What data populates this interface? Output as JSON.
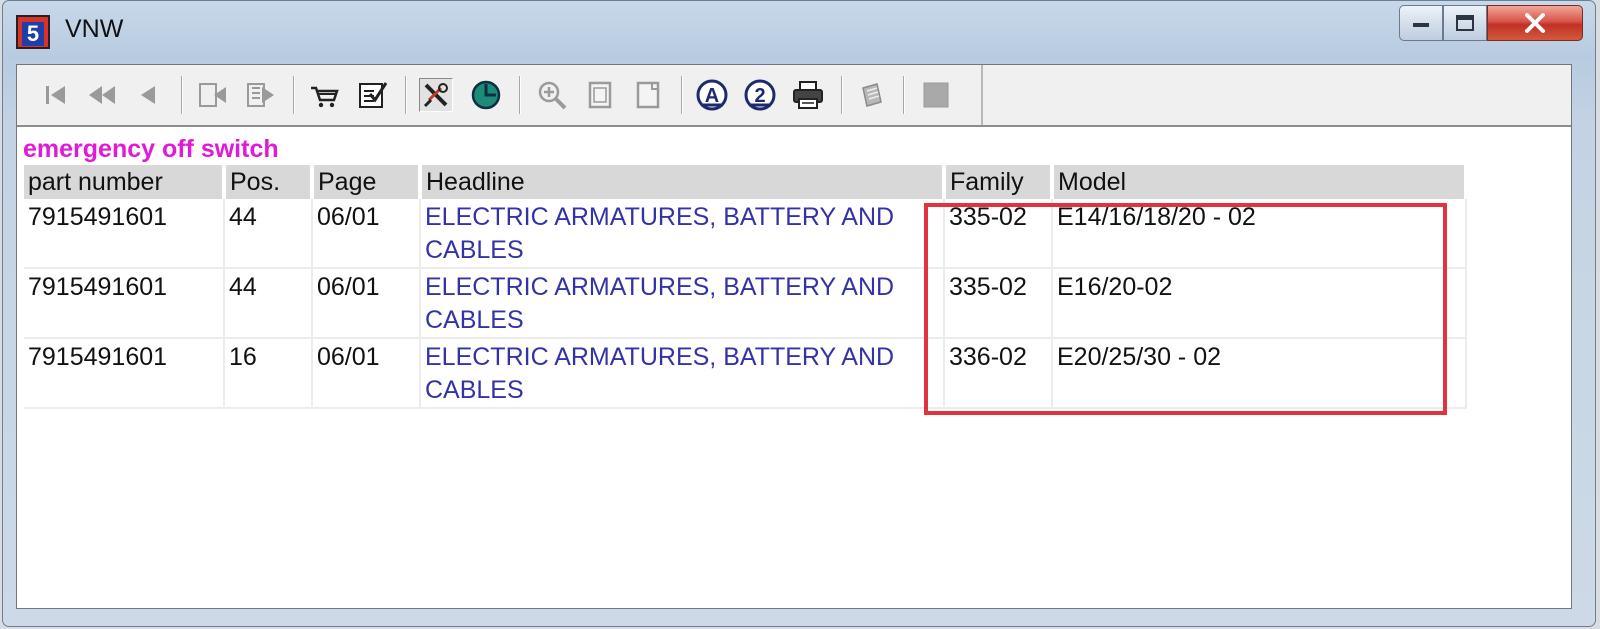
{
  "window": {
    "title": "VNW",
    "app_icon_glyph": "5",
    "controls": {
      "minimize_icon": "minimize-icon",
      "maximize_icon": "maximize-icon",
      "close_icon": "close-icon"
    }
  },
  "toolbar": {
    "buttons": [
      {
        "name": "first-record-icon",
        "enabled": false
      },
      {
        "name": "previous-page-icon",
        "enabled": false
      },
      {
        "name": "previous-record-icon",
        "enabled": false
      },
      {
        "name": "back-to-list-icon",
        "enabled": false
      },
      {
        "name": "forward-to-list-icon",
        "enabled": false
      },
      {
        "name": "cart-icon",
        "enabled": true
      },
      {
        "name": "checklist-icon",
        "enabled": true
      },
      {
        "name": "parts-search-icon",
        "enabled": true,
        "pressed": true
      },
      {
        "name": "globe-icon",
        "enabled": true
      },
      {
        "name": "zoom-in-icon",
        "enabled": false
      },
      {
        "name": "page-fit-icon",
        "enabled": false
      },
      {
        "name": "page-width-icon",
        "enabled": false
      },
      {
        "name": "option-a-icon",
        "enabled": true
      },
      {
        "name": "option-2-icon",
        "enabled": true
      },
      {
        "name": "print-icon",
        "enabled": true
      },
      {
        "name": "notes-icon",
        "enabled": false
      },
      {
        "name": "stop-icon",
        "enabled": false
      }
    ]
  },
  "subject": "emergency off switch",
  "table": {
    "headers": [
      "part number",
      "Pos.",
      "Page",
      "Headline",
      "Family",
      "Model"
    ],
    "rows": [
      [
        "7915491601",
        "44",
        "06/01",
        "ELECTRIC ARMATURES, BATTERY AND CABLES",
        "335-02",
        "E14/16/18/20 - 02"
      ],
      [
        "7915491601",
        "44",
        "06/01",
        "ELECTRIC ARMATURES, BATTERY AND CABLES",
        "335-02",
        "E16/20-02"
      ],
      [
        "7915491601",
        "16",
        "06/01",
        "ELECTRIC ARMATURES, BATTERY AND CABLES",
        "336-02",
        "E20/25/30 - 02"
      ]
    ]
  },
  "colors": {
    "subject": "#e01ad8",
    "headline_link": "#3333a8",
    "highlight_box": "#e0333f"
  }
}
